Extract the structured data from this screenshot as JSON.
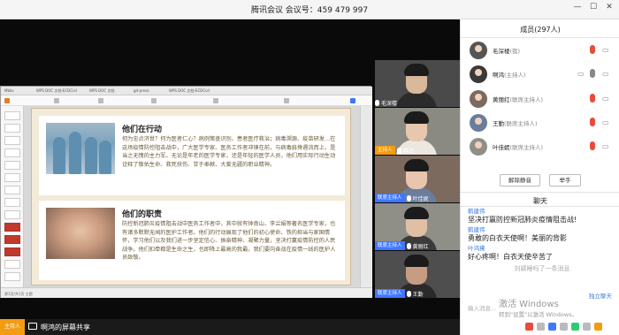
{
  "window": {
    "title": "腾讯会议  会议号：459 479 997",
    "controls": {
      "minimize": "—",
      "maximize": "☐",
      "close": "✕"
    }
  },
  "ppt": {
    "tabs": [
      "Mbbs",
      "WPS DOC 文档-ECDCcd",
      "WPS DOC 文档",
      "gd-preso",
      "WPS DOC 文档-ECDCcd"
    ],
    "status_left": "第1页/共1页  主题",
    "cards": [
      {
        "title": "他们在行动",
        "body": "何为忠贞济世？何为医者仁心？病例策查识別、患者医疗救治；病毒溯源、疫苗研发…在这场疫情防控阻击战中，广大医学专家、医务工作者冲锋在前，与病毒肩搀遇流而上，是当之无愧的主力军。无论是年老的医学专家，还是年轻的医学人员，他们用实际行动生动诠释了敬佑生命、救死扶伤、甘于奉献、大爱无疆的职业精神。"
      },
      {
        "title": "他们的职责",
        "body": "防控新冠肺炎疫情阻击战中医务工作者中，其中就有钟南山、李兰娟等著名医学专家，也有诸多默默无闻的医护工作者。他们的行动展现了他们的初心使命、铁的担当与家国情怀，学习他们以及我们进一步坚定信心、振奋精神、凝聚力量，坚决打赢疫情防控的人民战争。他们扣牵都是生命之生，也即降上最高的我最。我们要向奋战在疫情一线的医护人员致敬。"
      }
    ]
  },
  "videos": [
    {
      "name": "毛深楼",
      "role": "",
      "skin": "#d9b89c",
      "shirt": "#2b2b2b",
      "bg": "#4a4a4a"
    },
    {
      "name": "啊鸿",
      "role": "主持人",
      "skin": "#e7c7ad",
      "shirt": "#ece8e0",
      "bg": "#8a8a82"
    },
    {
      "name": "叶佳妮",
      "role": "联席主持人",
      "skin": "#e8c5ad",
      "shirt": "#6a7d9c",
      "bg": "#7c6a5f"
    },
    {
      "name": "黄丽红",
      "role": "联席主持人",
      "skin": "#e1bfa5",
      "shirt": "#3b3b3b",
      "bg": "#8f8f88"
    },
    {
      "name": "王勤",
      "role": "联席主持人",
      "skin": "#c89c82",
      "shirt": "#2a2a2a",
      "bg": "#4e4e4e"
    }
  ],
  "share_bar": {
    "host_tag": "主持人",
    "text": "啊鸿的屏幕共享"
  },
  "members": {
    "title": "成员(297人)",
    "list": [
      {
        "name": "毛深楼",
        "role": "(我)"
      },
      {
        "name": "啊鸿",
        "role": "(主持人)"
      },
      {
        "name": "黄丽红",
        "role": "(联席主持人)"
      },
      {
        "name": "王勤",
        "role": "(联席主持人)"
      },
      {
        "name": "叶佳妮",
        "role": "(联席主持人)"
      }
    ],
    "mute_all_label": "解除静音",
    "raise_hand_label": "举手"
  },
  "chat": {
    "title": "聊天",
    "messages": [
      {
        "sender": "鹤建伟",
        "text": "坚决打赢防控新冠肺炎疫情阻击战!"
      },
      {
        "sender": "鹤建伟",
        "text": "勇敢的白衣天使啊！美丽的背影"
      },
      {
        "sender": "叶鸿拂",
        "text": "好心疼啊！白衣天使辛苦了"
      }
    ],
    "system_note": "刘颖睡吗了一条消息",
    "input_placeholder": "输入消息…",
    "send_target": "独立聊天"
  },
  "windows_activation": {
    "title": "激活 Windows",
    "subtitle": "转到\"设置\"以激活 Windows。"
  },
  "colors": {
    "accent": "#f39c12",
    "link": "#3b7ddd",
    "mic_off": "#e74c3c",
    "mic_on": "#2ecc71"
  }
}
